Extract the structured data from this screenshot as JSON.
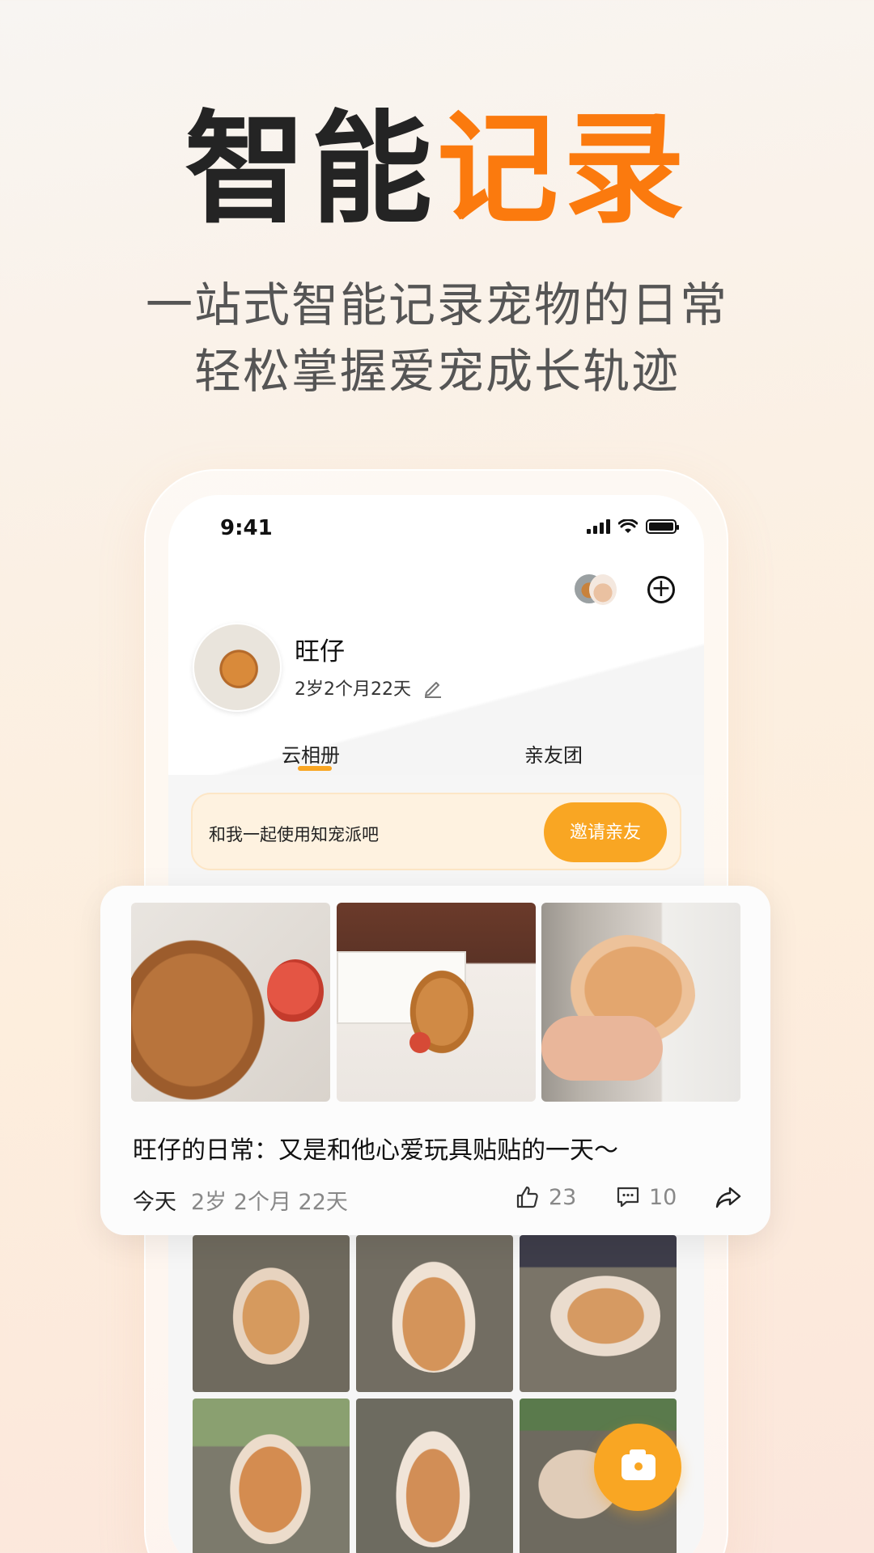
{
  "hero": {
    "title_dark": "智能",
    "title_accent": "记录",
    "subtitle_line1": "一站式智能记录宠物的日常",
    "subtitle_line2": "轻松掌握爱宠成长轨迹"
  },
  "status_bar": {
    "time": "9:41"
  },
  "profile": {
    "name": "旺仔",
    "age": "2岁2个月22天"
  },
  "tabs": [
    {
      "label": "云相册",
      "active": true
    },
    {
      "label": "亲友团",
      "active": false
    }
  ],
  "invite": {
    "text": "和我一起使用知宠派吧",
    "button_label": "邀请亲友"
  },
  "post": {
    "title": "旺仔的日常：又是和他心爱玩具贴贴的一天～",
    "date": "今天",
    "age": "2岁 2个月 22天",
    "likes": "23",
    "comments": "10"
  },
  "icons": {
    "add": "plus-circle-icon",
    "edit": "pencil-icon",
    "like": "thumbs-up-icon",
    "comment": "comment-icon",
    "share": "share-icon",
    "camera": "camera-icon"
  },
  "colors": {
    "accent_orange": "#fb7a0e",
    "button_orange": "#f9a623",
    "invite_bg": "#fef2e0"
  }
}
